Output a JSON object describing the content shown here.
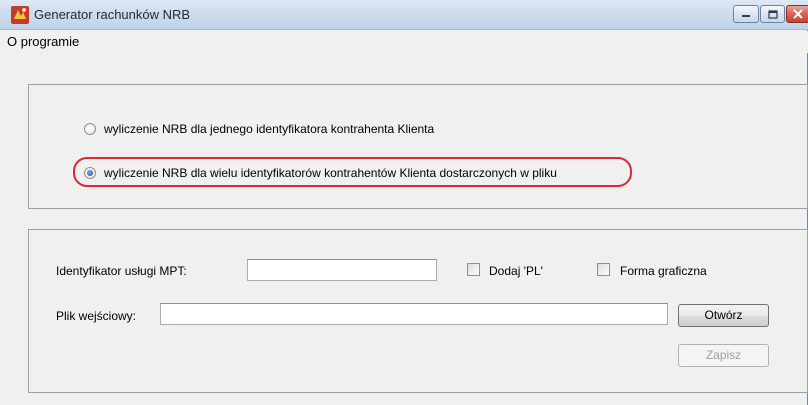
{
  "window": {
    "title": "Generator rachunków NRB",
    "app_icon": "app-logo-icon",
    "controls": [
      "minimize-icon",
      "maximize-icon",
      "close-icon"
    ]
  },
  "menu": {
    "items": [
      {
        "label": "O programie"
      }
    ]
  },
  "mode": {
    "options": [
      {
        "label": "wyliczenie NRB dla jednego identyfikatora kontrahenta Klienta",
        "checked": false
      },
      {
        "label": "wyliczenie NRB dla wielu identyfikatorów kontrahentów Klienta dostarczonych w pliku",
        "checked": true
      }
    ]
  },
  "form": {
    "service_id_label": "Identyfikator usługi MPT:",
    "service_id_value": "",
    "add_pl_label": "Dodaj 'PL'",
    "add_pl_checked": false,
    "graphic_form_label": "Forma graficzna",
    "graphic_form_checked": false,
    "input_file_label": "Plik wejściowy:",
    "input_file_value": "",
    "open_button": "Otwórz",
    "save_button": "Zapisz",
    "save_enabled": false
  },
  "colors": {
    "highlight": "#e0262e",
    "title_bar": "#cfdcec",
    "close_button": "#c7432f"
  }
}
